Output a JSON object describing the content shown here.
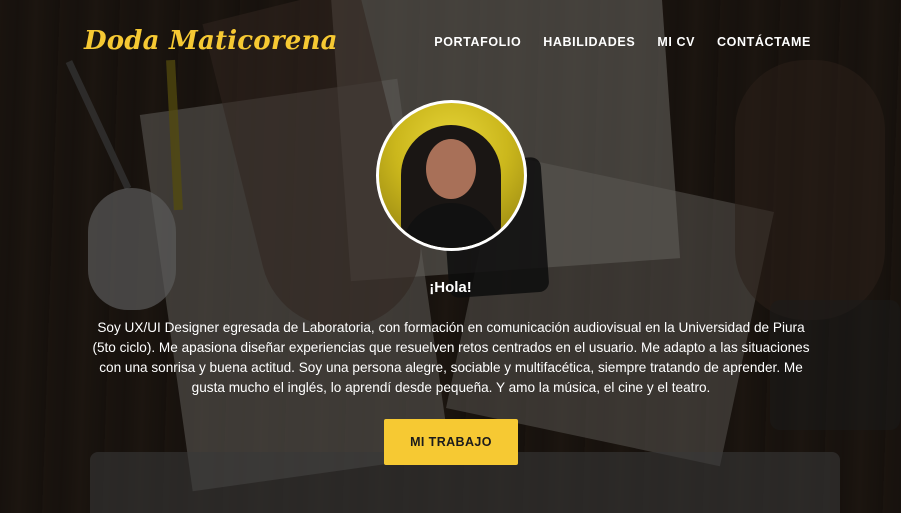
{
  "brand": {
    "name": "Doda Maticorena",
    "accent_color": "#f6c933"
  },
  "nav": {
    "items": [
      {
        "label": "PORTAFOLIO"
      },
      {
        "label": "HABILIDADES"
      },
      {
        "label": "MI CV"
      },
      {
        "label": "CONTÁCTAME"
      }
    ]
  },
  "hero": {
    "greeting": "¡Hola!",
    "bio": "Soy UX/UI Designer egresada de Laboratoria, con formación en comunicación audiovisual en la Universidad de Piura (5to ciclo). Me apasiona diseñar experiencias que resuelven retos centrados en el usuario. Me adapto a las situaciones con una sonrisa y buena actitud. Soy una persona alegre, sociable y multifacética, siempre tratando de aprender. Me gusta mucho el inglés, lo aprendí desde pequeña. Y amo la música, el cine y el teatro.",
    "cta_label": "MI TRABAJO"
  }
}
